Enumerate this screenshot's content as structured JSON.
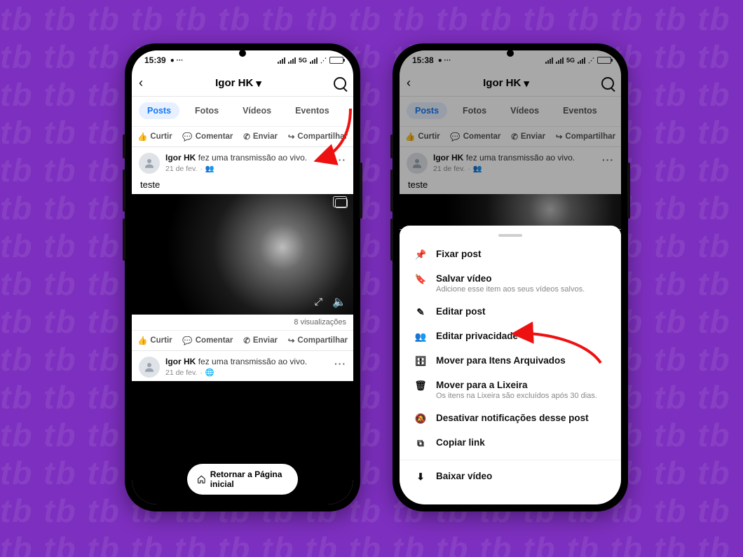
{
  "phone1": {
    "time": "15:39",
    "network": "5G",
    "title": "Igor HK",
    "tabs": {
      "posts": "Posts",
      "fotos": "Fotos",
      "videos": "Vídeos",
      "eventos": "Eventos"
    },
    "actions": {
      "curtir": "Curtir",
      "comentar": "Comentar",
      "enviar": "Enviar",
      "compartilhar": "Compartilhar"
    },
    "post": {
      "author": "Igor HK",
      "rest": "fez uma transmissão ao vivo.",
      "date": "21 de fev.",
      "caption": "teste",
      "views": "8 visualizações"
    },
    "post2": {
      "author": "Igor HK",
      "rest": "fez uma transmissão ao vivo.",
      "date": "21 de fev."
    },
    "home": "Retornar a Página inicial"
  },
  "phone2": {
    "time": "15:38",
    "network": "5G",
    "title": "Igor HK",
    "tabs": {
      "posts": "Posts",
      "fotos": "Fotos",
      "videos": "Vídeos",
      "eventos": "Eventos"
    },
    "actions": {
      "curtir": "Curtir",
      "comentar": "Comentar",
      "enviar": "Enviar",
      "compartilhar": "Compartilhar"
    },
    "post": {
      "author": "Igor HK",
      "rest": "fez uma transmissão ao vivo.",
      "date": "21 de fev.",
      "caption": "teste"
    },
    "sheet": {
      "fixar": "Fixar post",
      "salvar": "Salvar vídeo",
      "salvar_sub": "Adicione esse item aos seus vídeos salvos.",
      "editar": "Editar post",
      "privacidade": "Editar privacidade",
      "arquivar": "Mover para Itens Arquivados",
      "lixeira": "Mover para a Lixeira",
      "lixeira_sub": "Os itens na Lixeira são excluídos após 30 dias.",
      "notif": "Desativar notificações desse post",
      "copiar": "Copiar link",
      "baixar": "Baixar vídeo"
    }
  }
}
